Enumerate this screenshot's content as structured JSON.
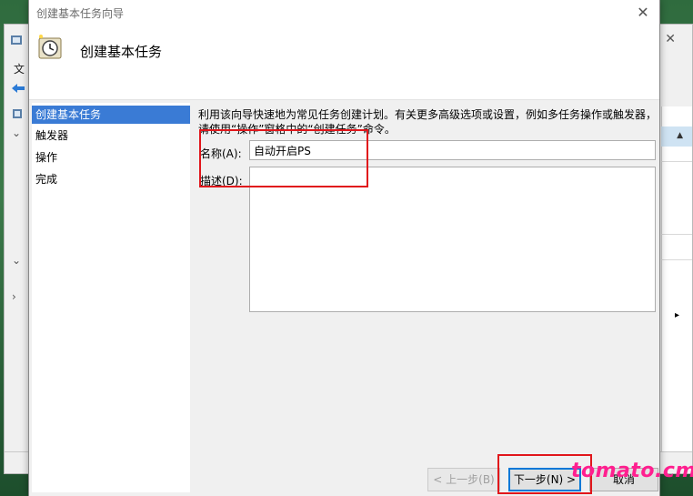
{
  "background_window": {
    "menu_label": "文",
    "right_arrow": "▸",
    "up_arrow": "▲"
  },
  "wizard": {
    "title": "创建基本任务向导",
    "close_glyph": "✕",
    "header_title": "创建基本任务",
    "steps": [
      {
        "label": "创建基本任务",
        "active": true
      },
      {
        "label": "触发器",
        "active": false
      },
      {
        "label": "操作",
        "active": false
      },
      {
        "label": "完成",
        "active": false
      }
    ],
    "description": "利用该向导快速地为常见任务创建计划。有关更多高级选项或设置，例如多任务操作或触发器，请使用“操作”窗格中的“创建任务”命令。",
    "name_label": "名称(A):",
    "name_value": "自动开启PS",
    "desc_label": "描述(D):",
    "desc_value": "",
    "buttons": {
      "back": "< 上一步(B)",
      "next": "下一步(N) >",
      "cancel": "取消"
    }
  },
  "watermark": "tomato.cm",
  "colors": {
    "selection": "#3a7bd5",
    "highlight_box": "#e1161b",
    "watermark": "#ff1f8f"
  }
}
